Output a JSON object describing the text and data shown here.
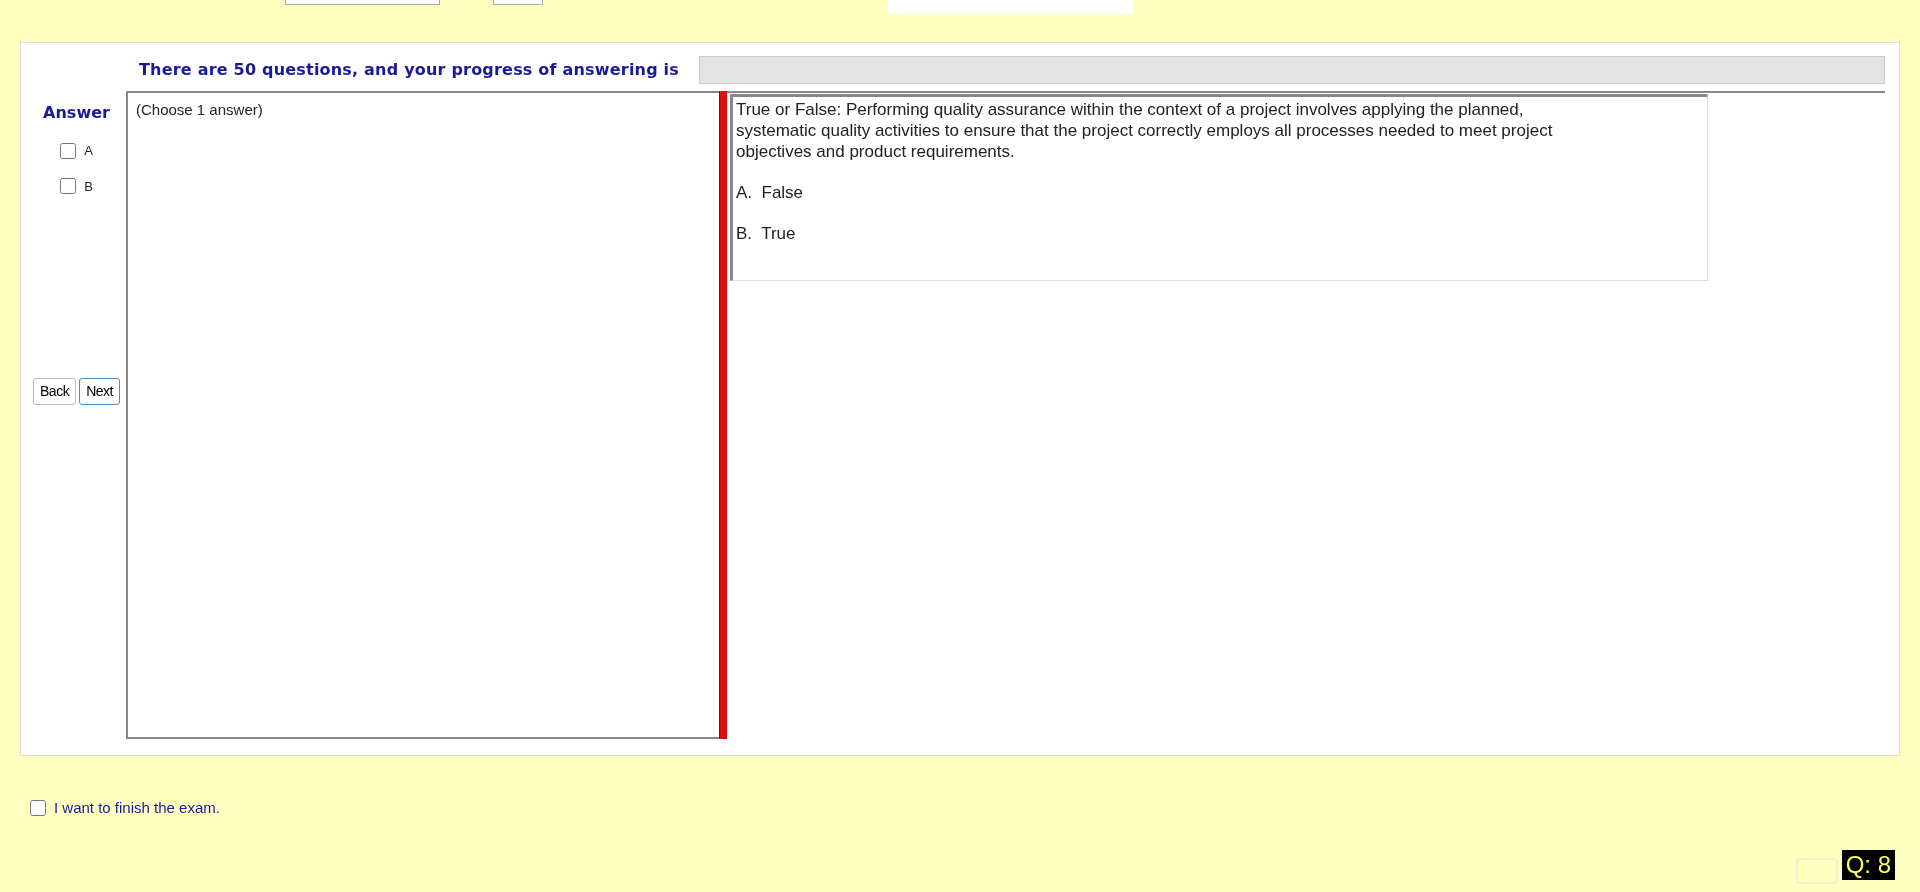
{
  "progress": {
    "label": "There are 50 questions, and your progress of answering is",
    "level": 0
  },
  "answer": {
    "title": "Answer",
    "options": [
      {
        "label": "A",
        "checked": false
      },
      {
        "label": "B",
        "checked": false
      }
    ]
  },
  "nav_buttons": [
    "Back",
    "Next"
  ],
  "answer_box": {
    "text": "(Choose 1 answer)"
  },
  "question": {
    "text": "True or False: Performing quality assurance within the context of a project involves applying the planned, systematic quality activities to ensure that the project correctly employs all processes needed to meet project objectives and product requirements.",
    "choices": [
      "A.  False",
      "B.  True"
    ]
  },
  "finish": {
    "label": "I want to finish the exam.",
    "checked": false
  },
  "question_counter": "Q: 8"
}
